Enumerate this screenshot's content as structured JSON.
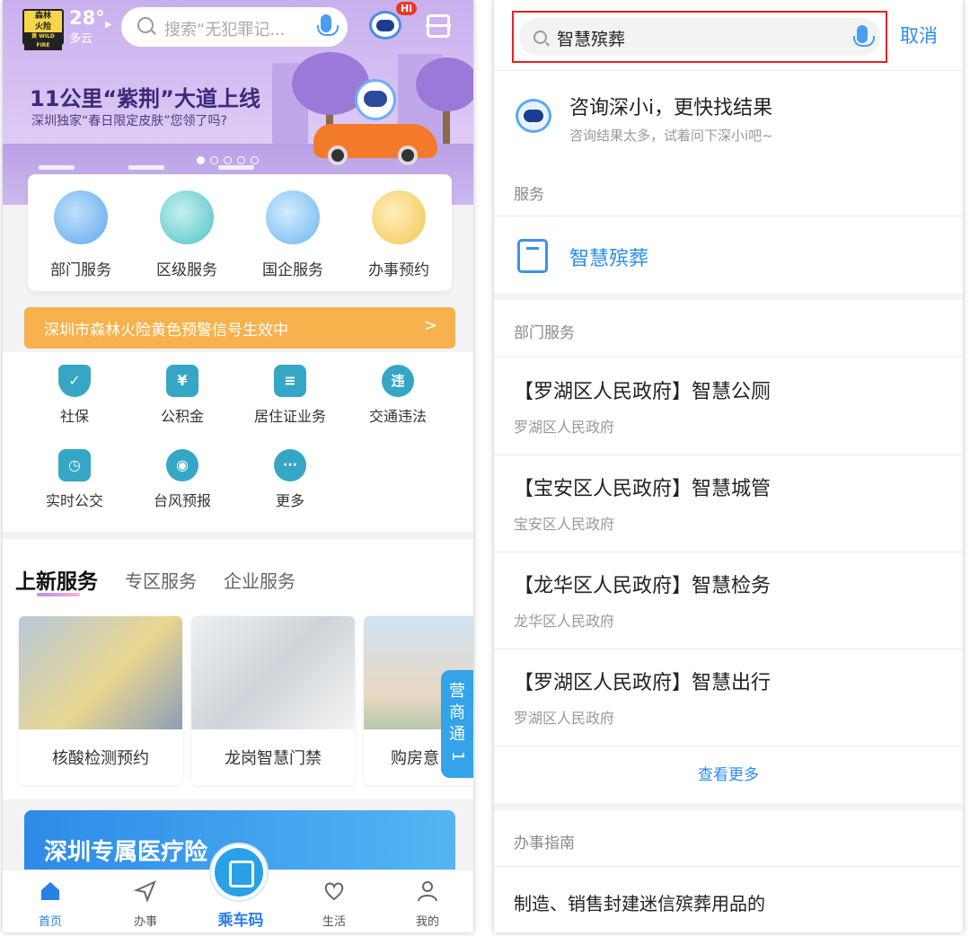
{
  "left": {
    "weather": {
      "badge_top": "森林",
      "badge_mid": "火险",
      "badge_bottom": "黄 WILD FIRE",
      "temp": "28°",
      "condition": "多云"
    },
    "search_placeholder": "搜索“无犯罪记...",
    "hi_badge": "Hi",
    "banner": {
      "title": "11公里“紫荆”大道上线",
      "subtitle": "深圳独家“春日限定皮肤”您领了吗?"
    },
    "services": [
      {
        "label": "部门服务",
        "color": "#5fa8ee"
      },
      {
        "label": "区级服务",
        "color": "#4cc3c9"
      },
      {
        "label": "国企服务",
        "color": "#69b6f2"
      },
      {
        "label": "办事预约",
        "color": "#f5c74f"
      }
    ],
    "alert": "深圳市森林火险黄色预警信号生效中",
    "quick_items": [
      {
        "label": "社保",
        "glyph": "✓"
      },
      {
        "label": "公积金",
        "glyph": "¥"
      },
      {
        "label": "居住证业务",
        "glyph": "≡"
      },
      {
        "label": "交通违法",
        "glyph": "违"
      },
      {
        "label": "实时公交",
        "glyph": "◷"
      },
      {
        "label": "台风预报",
        "glyph": "◉"
      },
      {
        "label": "更多",
        "glyph": "···"
      }
    ],
    "tabs": [
      "上新服务",
      "专区服务",
      "企业服务"
    ],
    "tiles": [
      "核酸检测预约",
      "龙岗智慧门禁",
      "购房意"
    ],
    "side_tab": [
      "营",
      "商",
      "通",
      "1"
    ],
    "medical_banner": "深圳专属医疗险",
    "nav": [
      "首页",
      "办事",
      "乘车码",
      "生活",
      "我的"
    ]
  },
  "right": {
    "search_value": "智慧殡葬",
    "cancel": "取消",
    "ask_title": "咨询深小i，更快找结果",
    "ask_sub": "咨询结果太多，试着问下深小i吧~",
    "section_service": "服务",
    "service_item": "智慧殡葬",
    "section_dept": "部门服务",
    "results": [
      {
        "title": "【罗湖区人民政府】智慧公厕",
        "sub": "罗湖区人民政府"
      },
      {
        "title": "【宝安区人民政府】智慧城管",
        "sub": "宝安区人民政府"
      },
      {
        "title": "【龙华区人民政府】智慧检务",
        "sub": "龙华区人民政府"
      },
      {
        "title": "【罗湖区人民政府】智慧出行",
        "sub": "罗湖区人民政府"
      }
    ],
    "more": "查看更多",
    "section_guide": "办事指南",
    "guide_item": "制造、销售封建迷信殡葬用品的"
  }
}
